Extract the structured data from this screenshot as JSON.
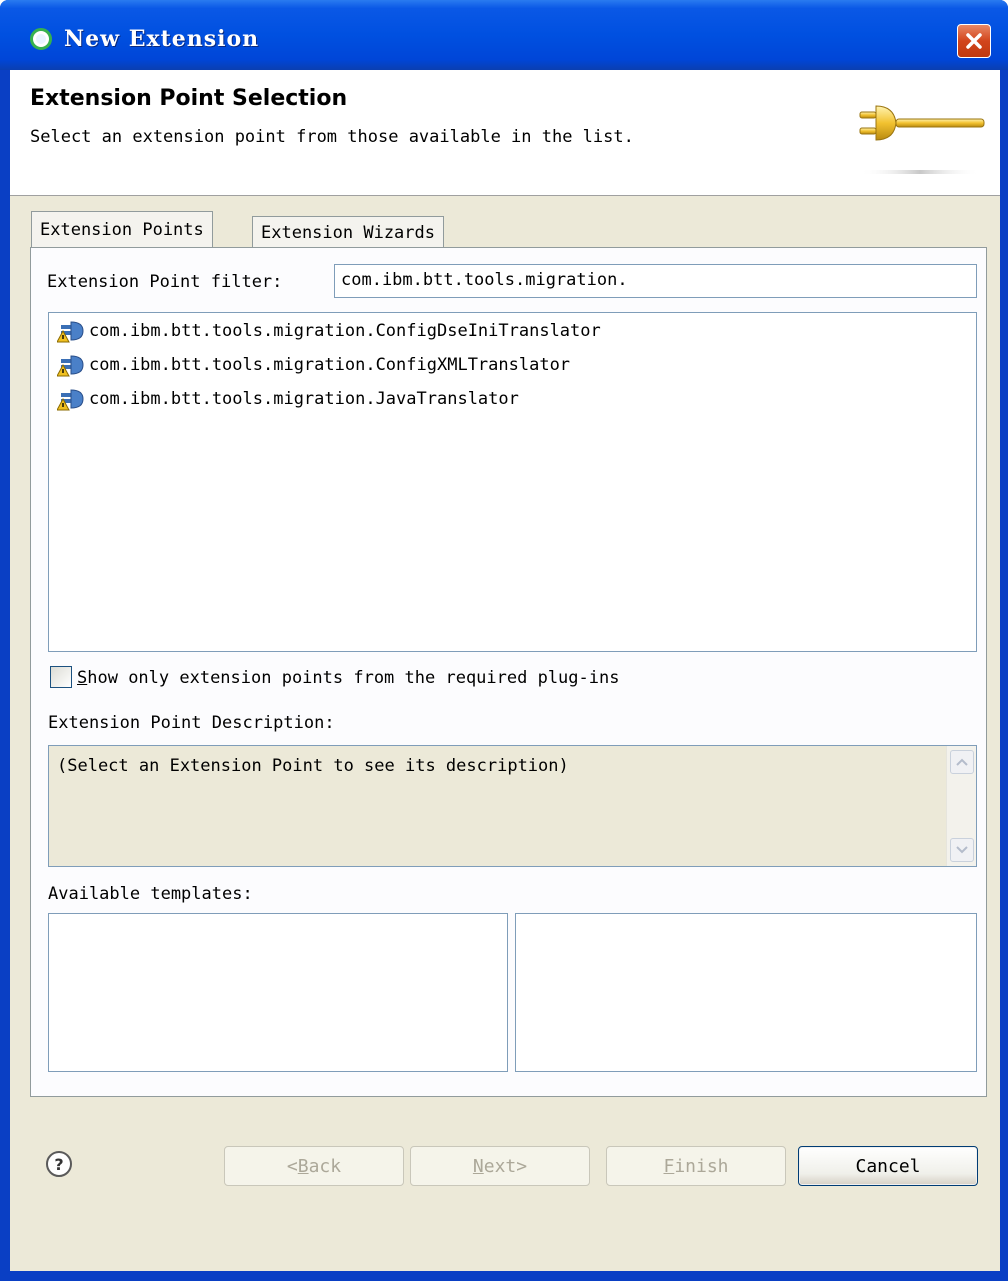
{
  "window": {
    "title": "New Extension"
  },
  "header": {
    "title": "Extension Point Selection",
    "description": "Select an extension point from those available in the list."
  },
  "tabs": [
    {
      "label": "Extension Points",
      "active": true
    },
    {
      "label": "Extension Wizards",
      "active": false
    }
  ],
  "filter": {
    "label": "Extension Point filter:",
    "value": "com.ibm.btt.tools.migration."
  },
  "extension_points": [
    {
      "label": "com.ibm.btt.tools.migration.ConfigDseIniTranslator",
      "icon": "extension-point-warning-icon"
    },
    {
      "label": "com.ibm.btt.tools.migration.ConfigXMLTranslator",
      "icon": "extension-point-warning-icon"
    },
    {
      "label": "com.ibm.btt.tools.migration.JavaTranslator",
      "icon": "extension-point-warning-icon"
    }
  ],
  "required_only": {
    "label_first": "S",
    "label_rest": "how only extension points from the required plug-ins",
    "checked": false
  },
  "description": {
    "label": "Extension Point Description:",
    "text": "(Select an Extension Point to see its description)"
  },
  "templates": {
    "label": "Available templates:"
  },
  "buttons": {
    "back_arrow": "< ",
    "back_first": "B",
    "back_rest": "ack",
    "next_first": "N",
    "next_rest": "ext",
    "next_arrow": " >",
    "finish_first": "F",
    "finish_rest": "inish",
    "cancel": "Cancel"
  },
  "colors": {
    "titlebar": "#0050e0",
    "dialog_bg": "#ece9d8",
    "active_tab_accent": "#ffc83c"
  }
}
